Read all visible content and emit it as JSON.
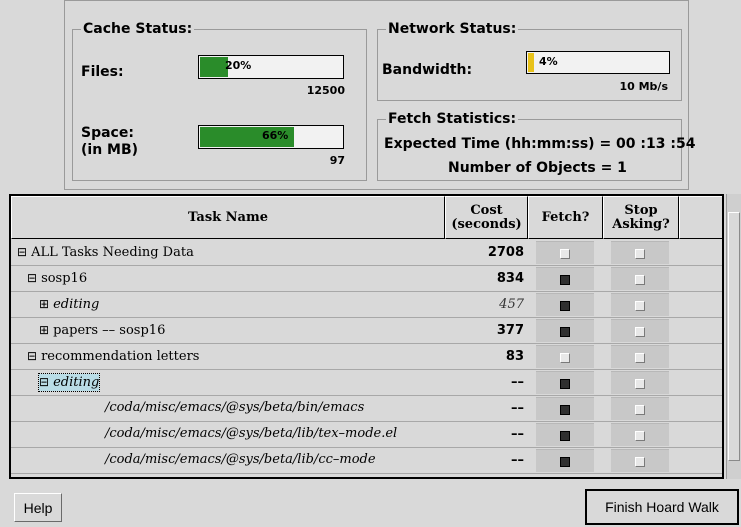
{
  "cache_status": {
    "title": "Cache Status:",
    "files_label": "Files:",
    "files_percent_text": "20%",
    "files_percent": 20,
    "files_max": "12500",
    "space_label": "Space:",
    "space_sub_label": "(in MB)",
    "space_percent_text": "66%",
    "space_percent": 66,
    "space_max": "97"
  },
  "network_status": {
    "title": "Network Status:",
    "bandwidth_label": "Bandwidth:",
    "bandwidth_percent_text": "4%",
    "bandwidth_percent": 4,
    "bandwidth_max": "10 Mb/s"
  },
  "fetch_statistics": {
    "title": "Fetch Statistics:",
    "expected_time": "Expected Time (hh:mm:ss) = 00 :13 :54",
    "num_objects": "Number of Objects = 1"
  },
  "table": {
    "headers": {
      "task_name": "Task Name",
      "cost_line1": "Cost",
      "cost_line2": "(seconds)",
      "fetch": "Fetch?",
      "stop_line1": "Stop",
      "stop_line2": "Asking?"
    },
    "rows": [
      {
        "toggle": "⊟",
        "name": "ALL Tasks Needing Data",
        "cost": "2708",
        "fetch": false,
        "stop": false
      },
      {
        "toggle": "⊟",
        "name": "sosp16",
        "cost": "834",
        "fetch": true,
        "stop": false
      },
      {
        "toggle": "⊞",
        "name": "editing",
        "cost": "457",
        "fetch": true,
        "stop": false
      },
      {
        "toggle": "⊞",
        "name": "papers –– sosp16",
        "cost": "377",
        "fetch": true,
        "stop": false
      },
      {
        "toggle": "⊟",
        "name": "recommendation letters",
        "cost": "83",
        "fetch": false,
        "stop": false
      },
      {
        "toggle": "⊟",
        "name": "editing",
        "cost": "––",
        "fetch": true,
        "stop": false
      },
      {
        "toggle": "",
        "name": "/coda/misc/emacs/@sys/beta/bin/emacs",
        "cost": "––",
        "fetch": true,
        "stop": false
      },
      {
        "toggle": "",
        "name": "/coda/misc/emacs/@sys/beta/lib/tex–mode.el",
        "cost": "––",
        "fetch": true,
        "stop": false
      },
      {
        "toggle": "",
        "name": "/coda/misc/emacs/@sys/beta/lib/cc–mode",
        "cost": "––",
        "fetch": true,
        "stop": false
      }
    ]
  },
  "buttons": {
    "help": "Help",
    "finish": "Finish Hoard Walk"
  },
  "colors": {
    "progress_green": "#2a8c2a",
    "bandwidth_yellow": "#e8c21a",
    "selection": "#b9dce6"
  }
}
